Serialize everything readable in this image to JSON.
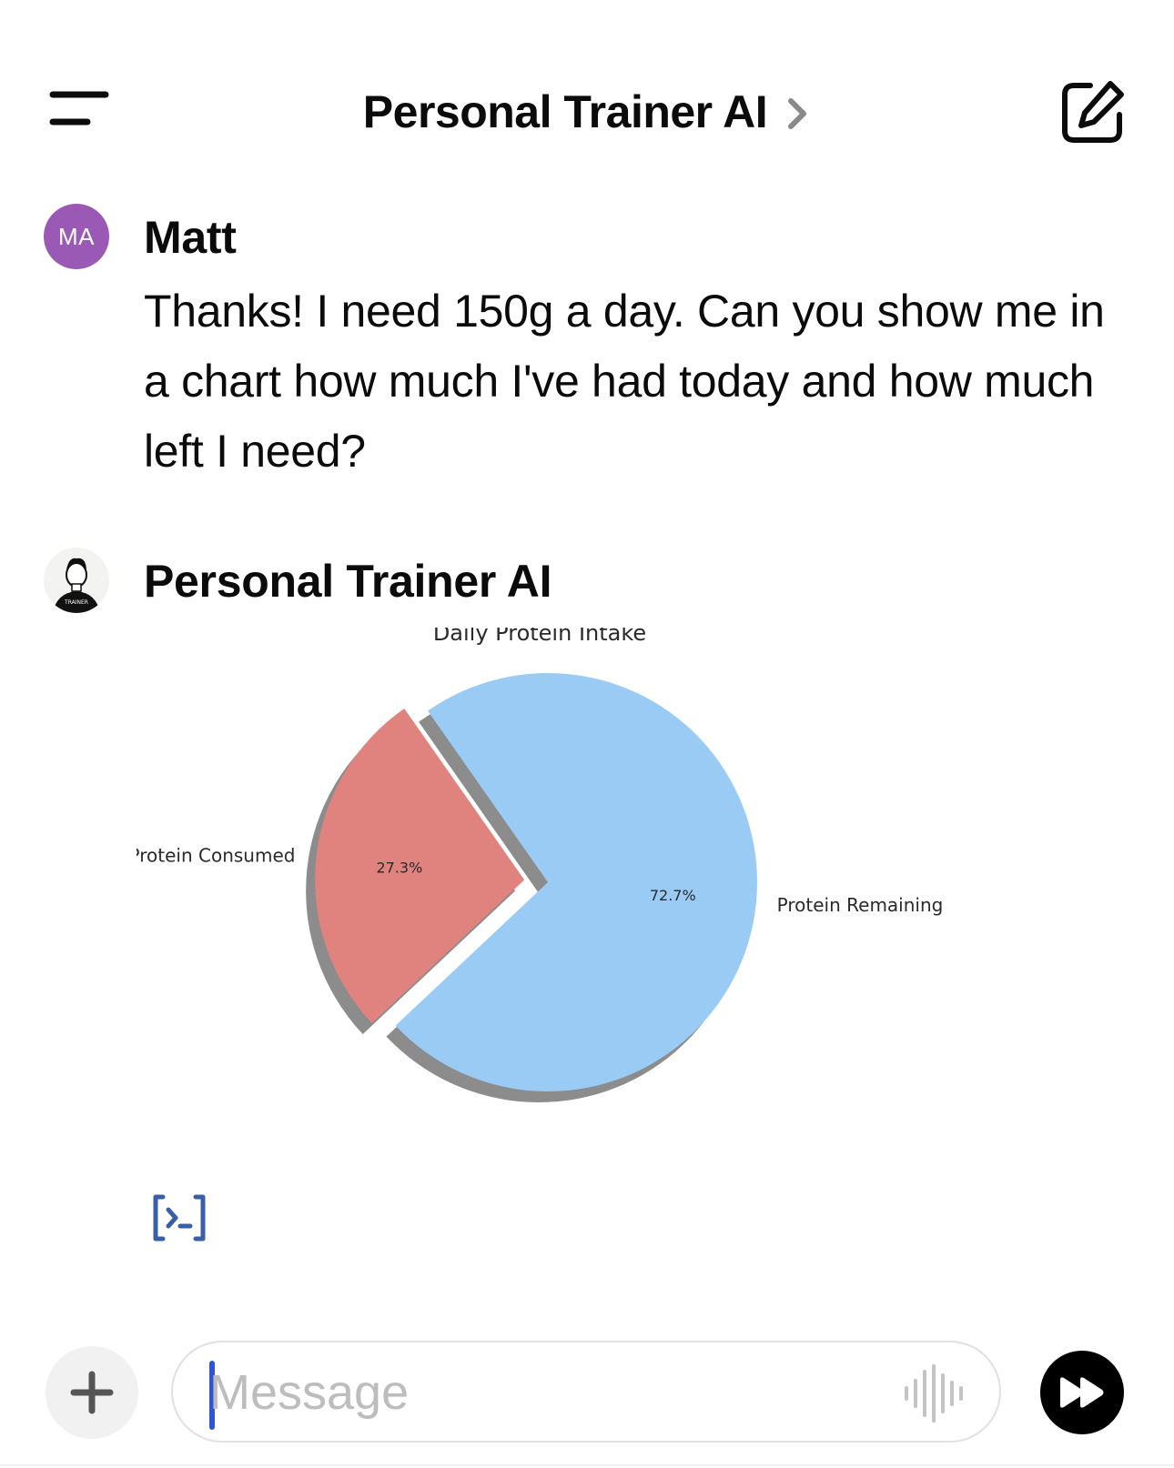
{
  "header": {
    "title": "Personal Trainer AI",
    "menu_icon": "hamburger-menu-icon",
    "chevron_icon": "chevron-right-icon",
    "compose_icon": "new-chat-edit-icon"
  },
  "messages": [
    {
      "sender": "Matt",
      "avatar_initials": "MA",
      "avatar_color": "#9b59b6",
      "text": "Thanks! I need 150g a day. Can you show me in a chart how much I've had today and how much left I need?"
    },
    {
      "sender": "Personal Trainer AI",
      "avatar_badge": "TRAINER"
    }
  ],
  "chart_data": {
    "type": "pie",
    "title": "Daily Protein Intake",
    "slices": [
      {
        "label": "Protein Consumed",
        "value": 27.3,
        "value_label": "27.3%",
        "color": "#e0827e",
        "exploded": true
      },
      {
        "label": "Protein Remaining",
        "value": 72.7,
        "value_label": "72.7%",
        "color": "#99cbf4",
        "exploded": false
      }
    ],
    "shadow": true
  },
  "code_button": {
    "icon": "code-interpreter-icon",
    "color": "#3a5fa8"
  },
  "composer": {
    "placeholder": "Message",
    "value": "",
    "plus_icon": "plus-icon",
    "voice_icon": "voice-waveform-icon",
    "send_icon": "fast-forward-send-icon"
  }
}
